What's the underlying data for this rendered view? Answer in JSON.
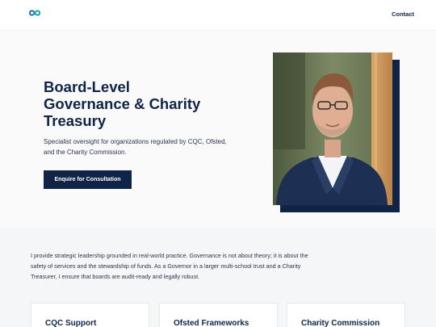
{
  "header": {
    "logo_icon": "infinity-logo-icon",
    "contact_label": "Contact"
  },
  "hero": {
    "title_lines": [
      "Board-Level",
      "Governance & Charity",
      "Treasury"
    ],
    "subtitle": "Specialist oversight for organizations regulated by CQC, Ofsted, and the Charity Commission.",
    "cta_label": "Enquire for Consultation"
  },
  "about": {
    "text": "I provide strategic leadership grounded in real-world practice. Governance is not about theory; it is about the safety of services and the stewardship of funds. As a Governor in a larger multi-school trust and a Charity Treasurer, I ensure that boards are audit-ready and legally robust."
  },
  "cards": [
    {
      "title": "CQC Support"
    },
    {
      "title": "Ofsted Frameworks"
    },
    {
      "title": "Charity Commission"
    }
  ],
  "colors": {
    "navy": "#0f2447",
    "logo_blue": "#1f6fb5",
    "logo_teal": "#22a3a9"
  }
}
